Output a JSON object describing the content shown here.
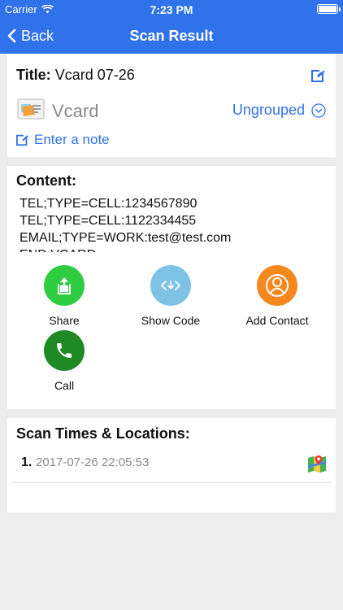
{
  "status_bar": {
    "carrier": "Carrier",
    "time": "7:23 PM"
  },
  "nav": {
    "back_label": "Back",
    "title": "Scan Result"
  },
  "summary": {
    "title_label": "Title:",
    "title_value": "Vcard 07-26",
    "type_name": "Vcard",
    "group_label": "Ungrouped",
    "note_placeholder": "Enter a note"
  },
  "content": {
    "label": "Content:",
    "lines": "TEL;TYPE=CELL:1234567890\nTEL;TYPE=CELL:1122334455\nEMAIL;TYPE=WORK:test@test.com\nEND:VCARD"
  },
  "actions": [
    {
      "label": "Share",
      "color": "#2ecc40",
      "icon": "share-icon"
    },
    {
      "label": "Show Code",
      "color": "#7ec3e6",
      "icon": "code-icon"
    },
    {
      "label": "Add Contact",
      "color": "#f5871f",
      "icon": "contact-icon"
    },
    {
      "label": "Call",
      "color": "#1f8a24",
      "icon": "phone-icon"
    }
  ],
  "scans": {
    "label": "Scan Times & Locations:",
    "items": [
      {
        "index": "1.",
        "timestamp": "2017-07-26 22:05:53"
      }
    ]
  },
  "colors": {
    "accent": "#2f72e9",
    "background": "#ededed"
  }
}
